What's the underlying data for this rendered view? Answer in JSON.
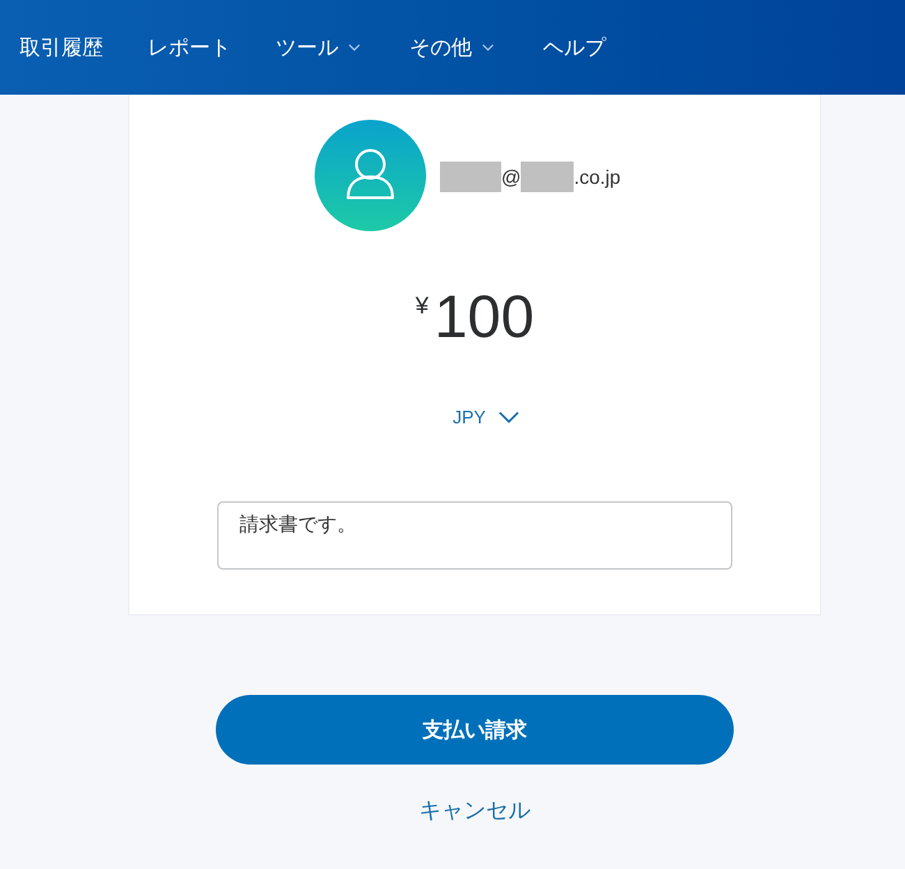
{
  "nav": {
    "items": [
      {
        "label": "取引履歴",
        "has_menu": false
      },
      {
        "label": "レポート",
        "has_menu": false
      },
      {
        "label": "ツール",
        "has_menu": true
      },
      {
        "label": "その他",
        "has_menu": true
      },
      {
        "label": "ヘルプ",
        "has_menu": false
      }
    ]
  },
  "recipient": {
    "email_parts": [
      {
        "kind": "redacted"
      },
      {
        "kind": "text",
        "text": "@"
      },
      {
        "kind": "redacted"
      },
      {
        "kind": "text",
        "text": ".co.jp"
      }
    ]
  },
  "amount": {
    "currency_symbol": "¥",
    "value": "100"
  },
  "currency": {
    "code": "JPY"
  },
  "note": {
    "value": "請求書です。"
  },
  "actions": {
    "primary": "支払い請求",
    "cancel": "キャンセル"
  }
}
